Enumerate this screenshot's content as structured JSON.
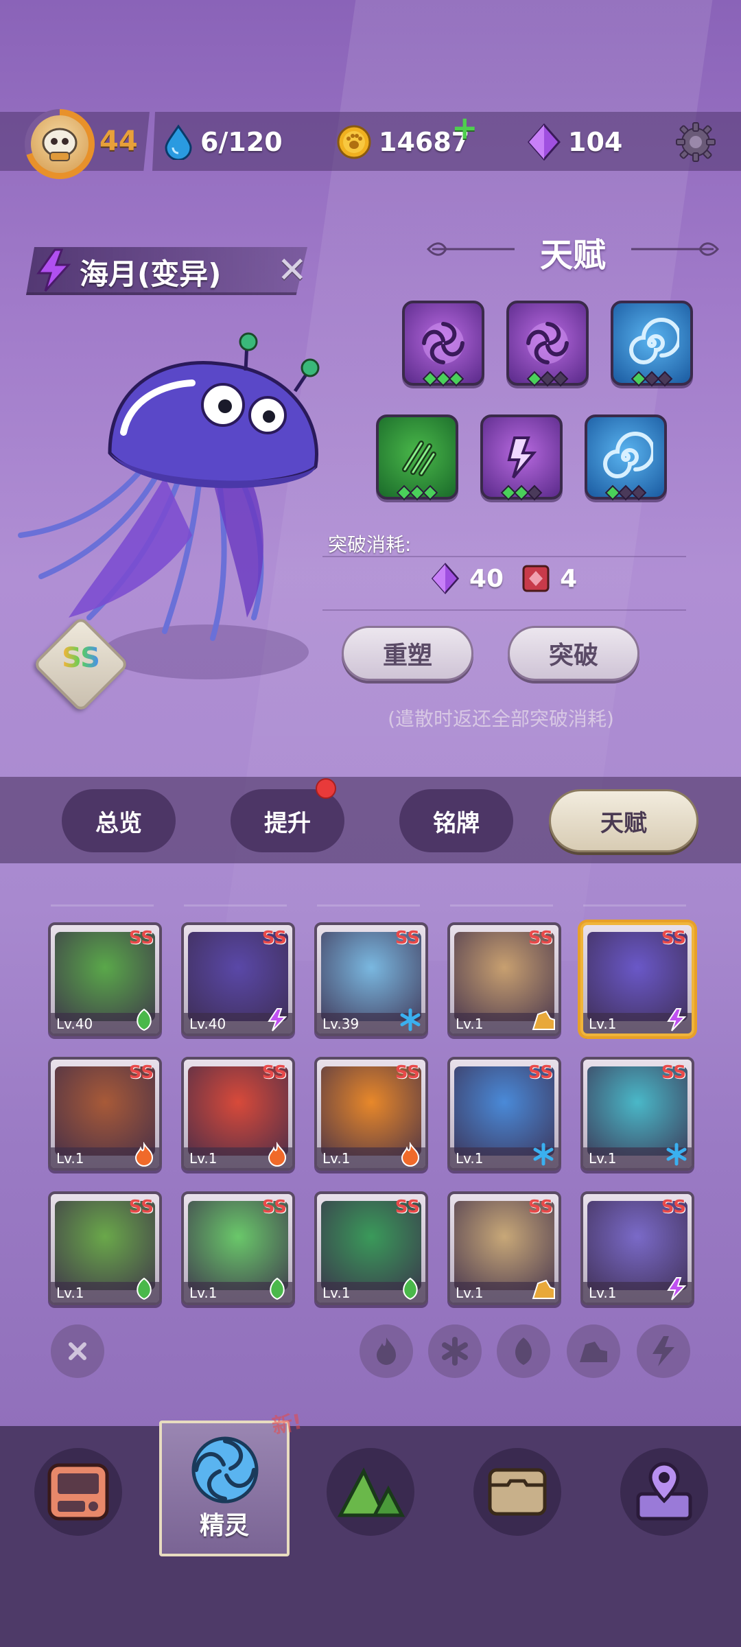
{
  "status": {
    "level": "44",
    "water": "6/120",
    "coins": "14687",
    "gems": "104"
  },
  "creature": {
    "name": "海月(变异)",
    "rank": "SS"
  },
  "talent": {
    "title": "天赋",
    "cost_label": "突破消耗:",
    "cost_gem": "40",
    "cost_item": "4",
    "reshape_label": "重塑",
    "breakthrough_label": "突破",
    "note": "(遣散时返还全部突破消耗)"
  },
  "tabs": {
    "overview": "总览",
    "upgrade": "提升",
    "nameplate": "铭牌",
    "talent": "天赋"
  },
  "cards": [
    {
      "rank": "SS",
      "level": "Lv.40",
      "element": "leaf"
    },
    {
      "rank": "SS",
      "level": "Lv.40",
      "element": "thunder"
    },
    {
      "rank": "SS",
      "level": "Lv.39",
      "element": "ice"
    },
    {
      "rank": "SS",
      "level": "Lv.1",
      "element": "earth"
    },
    {
      "rank": "SS",
      "level": "Lv.1",
      "element": "thunder"
    },
    {
      "rank": "SS",
      "level": "Lv.1",
      "element": "fire"
    },
    {
      "rank": "SS",
      "level": "Lv.1",
      "element": "fire"
    },
    {
      "rank": "SS",
      "level": "Lv.1",
      "element": "fire"
    },
    {
      "rank": "SS",
      "level": "Lv.1",
      "element": "ice"
    },
    {
      "rank": "SS",
      "level": "Lv.1",
      "element": "ice"
    },
    {
      "rank": "SS",
      "level": "Lv.1",
      "element": "leaf"
    },
    {
      "rank": "SS",
      "level": "Lv.1",
      "element": "leaf"
    },
    {
      "rank": "SS",
      "level": "Lv.1",
      "element": "leaf"
    },
    {
      "rank": "SS",
      "level": "Lv.1",
      "element": "earth"
    },
    {
      "rank": "SS",
      "level": "Lv.1",
      "element": "thunder"
    }
  ],
  "nav": {
    "spirit_label": "精灵",
    "new_badge": "新!"
  },
  "colors": {
    "accent_orange": "#e8a03a",
    "talent_purple": "#5a2a8a",
    "talent_blue": "#1a5aa0",
    "talent_green": "#1a6a2a",
    "rank_red": "#e84a4a"
  }
}
